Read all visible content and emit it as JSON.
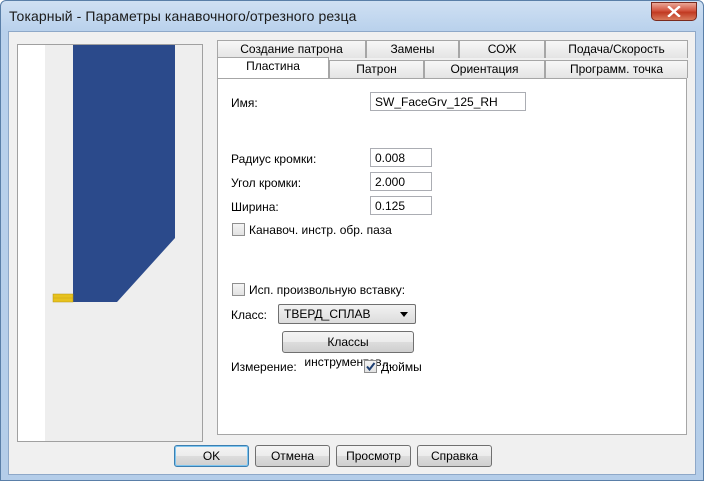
{
  "window": {
    "title": "Токарный - Параметры канавочного/отрезного резца"
  },
  "tabs": {
    "row1": [
      {
        "label": "Создание патрона"
      },
      {
        "label": "Замены"
      },
      {
        "label": "СОЖ"
      },
      {
        "label": "Подача/Скорость"
      }
    ],
    "row2": [
      {
        "label": "Пластина",
        "active": true
      },
      {
        "label": "Патрон"
      },
      {
        "label": "Ориентация"
      },
      {
        "label": "Программ. точка"
      }
    ]
  },
  "insert": {
    "name_label": "Имя:",
    "name_value": "SW_FaceGrv_125_RH",
    "corner_radius_label": "Радиус кромки:",
    "corner_radius_value": "0.008",
    "corner_angle_label": "Угол кромки:",
    "corner_angle_value": "2.000",
    "width_label": "Ширина:",
    "width_value": "0.125",
    "face_groove_label": "Канавоч. инстр. обр. паза",
    "face_groove_checked": false,
    "custom_insert_label": "Исп. произвольную вставку:",
    "custom_insert_checked": false,
    "class_label": "Класс:",
    "class_value": "ТВЕРД_СПЛАВ",
    "tool_classes_button": "Классы инструментов...",
    "units_label": "Измерение:",
    "units_option_label": "Дюймы",
    "units_inches_checked": true
  },
  "buttons": {
    "ok": "OK",
    "cancel": "Отмена",
    "preview": "Просмотр",
    "help": "Справка"
  },
  "colors": {
    "tool_body": "#2b4a8b",
    "insert_tip": "#e7c21e"
  }
}
